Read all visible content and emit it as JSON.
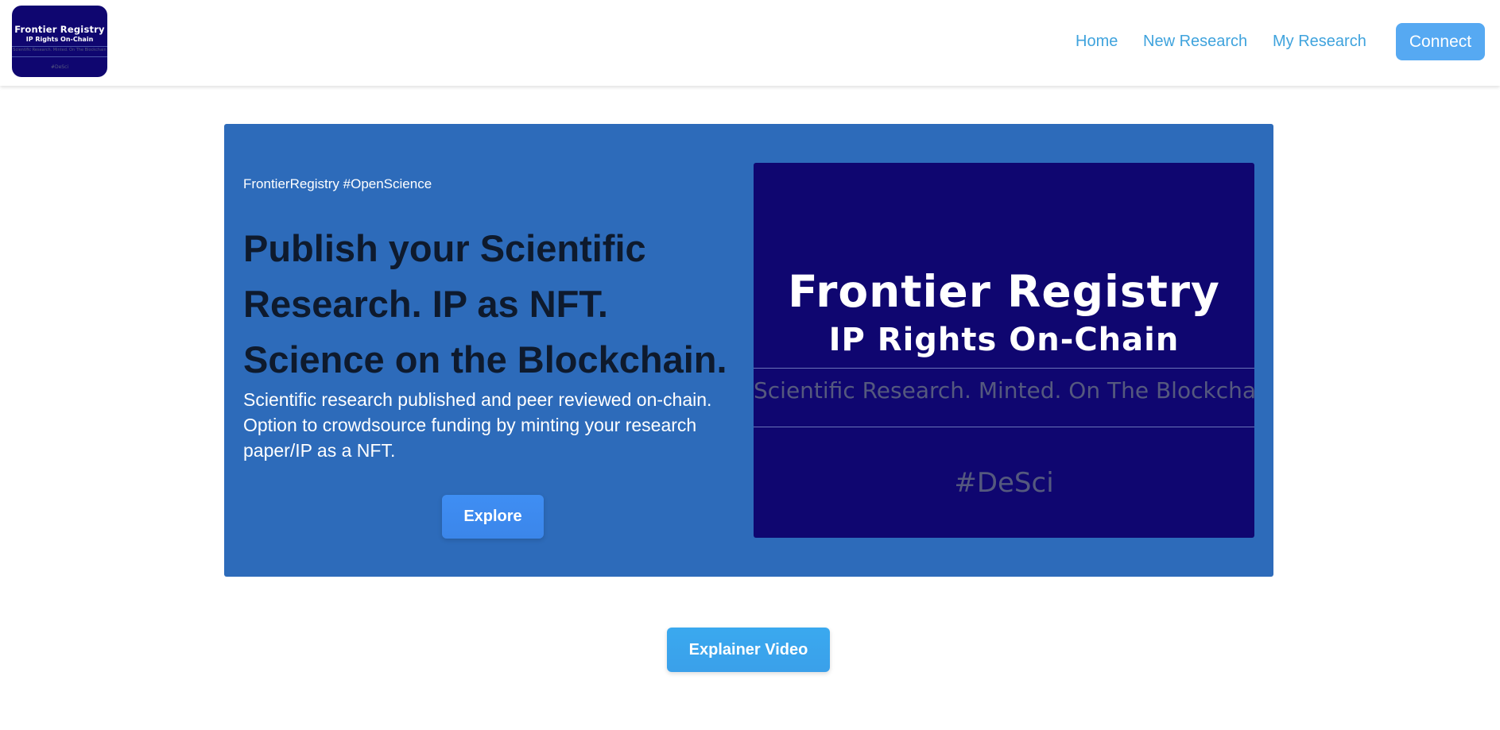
{
  "navbar": {
    "logo": {
      "title": "Frontier Registry",
      "subtitle": "IP Rights On-Chain",
      "tagline": "Scientific Research. Minted. On The Blockchain",
      "hashtag": "#DeSci"
    },
    "links": [
      {
        "label": "Home"
      },
      {
        "label": "New Research"
      },
      {
        "label": "My Research"
      }
    ],
    "connect_label": "Connect"
  },
  "hero": {
    "tag": "FrontierRegistry #OpenScience",
    "title": "Publish your Scientific Research. IP as NFT. Science on the Blockchain.",
    "description": "Scientific research published and peer reviewed on-chain. Option to crowdsource funding by minting your research paper/IP as a NFT.",
    "explore_label": "Explore",
    "banner": {
      "title": "Frontier Registry",
      "subtitle": "IP Rights On-Chain",
      "tagline": "Scientific Research. Minted. On The Blockchain",
      "hashtag": "#DeSci"
    }
  },
  "explainer_video_label": "Explainer Video",
  "colors": {
    "hero_bg": "#2d6bba",
    "banner_bg": "#0f0670",
    "link": "#3fa3dd",
    "button": "#56a9f2"
  }
}
